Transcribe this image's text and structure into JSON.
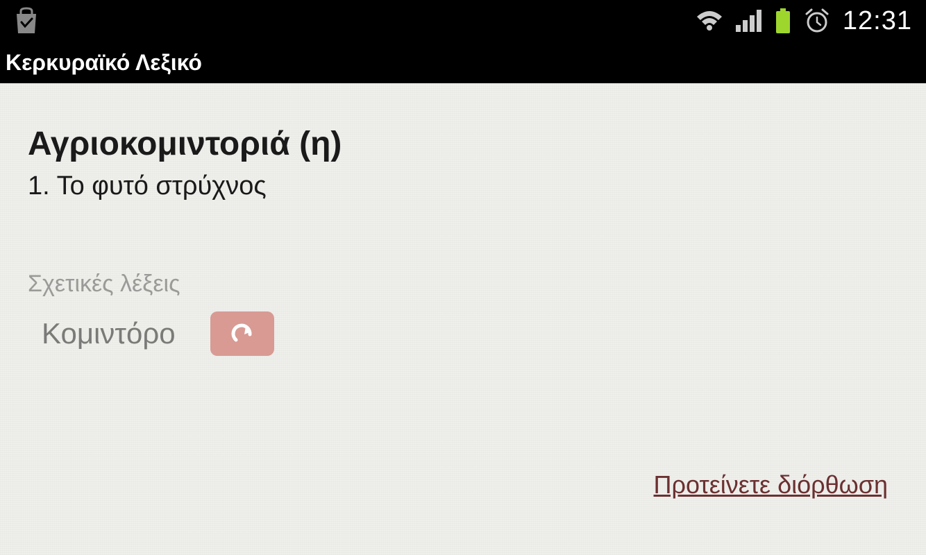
{
  "status": {
    "time": "12:31"
  },
  "app": {
    "title": "Κερκυραϊκό Λεξικό"
  },
  "entry": {
    "word": "Αγριοκομιντοριά (η)",
    "definition": "1. Το φυτό στρύχνος"
  },
  "related": {
    "label": "Σχετικές λέξεις",
    "items": [
      {
        "word": "Κομιντόρο"
      }
    ]
  },
  "actions": {
    "suggest_correction": "Προτείνετε διόρθωση"
  }
}
